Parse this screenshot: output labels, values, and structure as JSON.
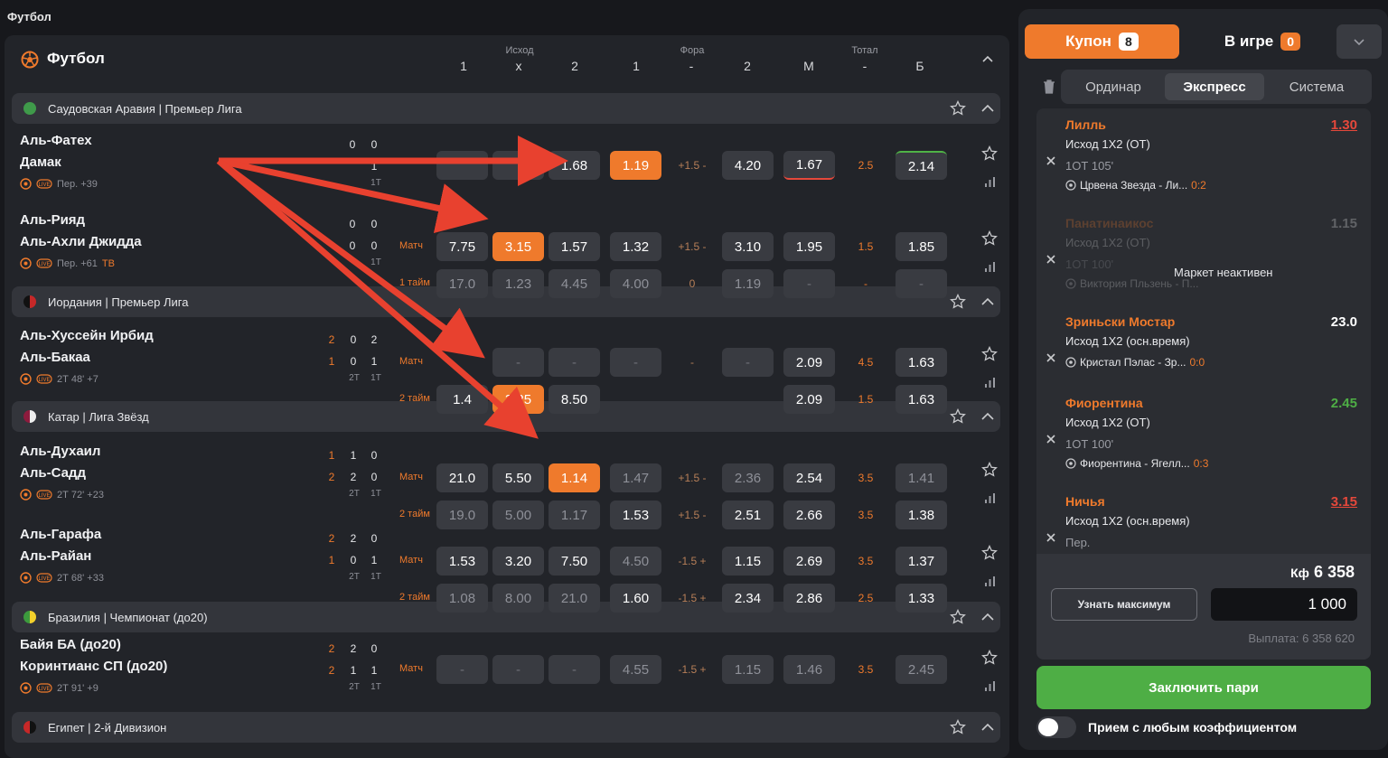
{
  "page_title": "Футбол",
  "header": {
    "sport": "Футбол",
    "groups": [
      "Исход",
      "Фора",
      "Тотал"
    ],
    "cols": [
      "1",
      "x",
      "2",
      "1",
      "-",
      "2",
      "М",
      "-",
      "Б"
    ]
  },
  "leagues": [
    "Саудовская Аравия | Премьер Лига",
    "Иордания | Премьер Лига",
    "Катар | Лига Звёзд",
    "Бразилия | Чемпионат (до20)",
    "Египет | 2-й Дивизион"
  ],
  "events": [
    {
      "t1": "Аль-Фатех",
      "t2": "Дамак",
      "meta": "Пер. +39",
      "meta2": "",
      "scores": [
        [
          "",
          "",
          "0",
          "0"
        ],
        [
          "",
          "",
          "",
          "1"
        ]
      ],
      "periods": [
        "",
        "1Т"
      ],
      "rows": [
        {
          "market": "",
          "odds": [
            "",
            "",
            "1.68",
            "1.19",
            "+1.5 -",
            "4.20",
            "1.67",
            "2.5",
            "2.14"
          ]
        }
      ]
    },
    {
      "t1": "Аль-Рияд",
      "t2": "Аль-Ахли Джидда",
      "meta": "Пер. +61",
      "meta2": "ТВ",
      "scores": [
        [
          "",
          "",
          "0",
          "0"
        ],
        [
          "",
          "",
          "0",
          "0"
        ]
      ],
      "periods": [
        "",
        "1Т"
      ],
      "rows": [
        {
          "market": "Матч",
          "odds": [
            "7.75",
            "3.15",
            "1.57",
            "1.32",
            "+1.5 -",
            "3.10",
            "1.95",
            "1.5",
            "1.85"
          ]
        },
        {
          "market": "1 тайм",
          "odds": [
            "17.0",
            "1.23",
            "4.45",
            "4.00",
            "0",
            "1.19",
            "-",
            "-",
            "-"
          ]
        }
      ]
    },
    {
      "t1": "Аль-Хуссейн Ирбид",
      "t2": "Аль-Бакаа",
      "meta": "2Т 48' +7",
      "meta2": "",
      "scores": [
        [
          "2",
          "0",
          "2"
        ],
        [
          "1",
          "0",
          "1"
        ]
      ],
      "periods": [
        "2Т",
        "1Т"
      ],
      "rows": [
        {
          "market": "Матч",
          "odds": [
            "",
            "-",
            "-",
            "-",
            "-",
            "-",
            "2.09",
            "4.5",
            "1.63"
          ]
        },
        {
          "market": "2 тайм",
          "odds": [
            "1.4",
            "3.25",
            "8.50",
            "",
            "",
            "",
            "2.09",
            "1.5",
            "1.63"
          ]
        }
      ]
    },
    {
      "t1": "Аль-Духаил",
      "t2": "Аль-Садд",
      "meta": "2Т 72' +23",
      "meta2": "",
      "scores": [
        [
          "1",
          "1",
          "0"
        ],
        [
          "2",
          "2",
          "0"
        ]
      ],
      "periods": [
        "2Т",
        "1Т"
      ],
      "rows": [
        {
          "market": "Матч",
          "odds": [
            "21.0",
            "5.50",
            "1.14",
            "1.47",
            "+1.5 -",
            "2.36",
            "2.54",
            "3.5",
            "1.41"
          ]
        },
        {
          "market": "2 тайм",
          "odds": [
            "19.0",
            "5.00",
            "1.17",
            "1.53",
            "+1.5 -",
            "2.51",
            "2.66",
            "3.5",
            "1.38"
          ]
        }
      ]
    },
    {
      "t1": "Аль-Гарафа",
      "t2": "Аль-Райан",
      "meta": "2Т 68' +33",
      "meta2": "",
      "scores": [
        [
          "2",
          "2",
          "0"
        ],
        [
          "1",
          "0",
          "1"
        ]
      ],
      "periods": [
        "2Т",
        "1Т"
      ],
      "rows": [
        {
          "market": "Матч",
          "odds": [
            "1.53",
            "3.20",
            "7.50",
            "4.50",
            "-1.5 +",
            "1.15",
            "2.69",
            "3.5",
            "1.37"
          ]
        },
        {
          "market": "2 тайм",
          "odds": [
            "1.08",
            "8.00",
            "21.0",
            "1.60",
            "-1.5 +",
            "2.34",
            "2.86",
            "2.5",
            "1.33"
          ]
        }
      ]
    },
    {
      "t1": "Байя БА (до20)",
      "t2": "Коринтианс СП (до20)",
      "meta": "2Т 91' +9",
      "meta2": "",
      "scores": [
        [
          "2",
          "2",
          "0"
        ],
        [
          "2",
          "1",
          "1"
        ]
      ],
      "periods": [
        "2Т",
        "1Т"
      ],
      "rows": [
        {
          "market": "Матч",
          "odds": [
            "-",
            "-",
            "-",
            "4.55",
            "-1.5 +",
            "1.15",
            "1.46",
            "3.5",
            "2.45"
          ]
        }
      ]
    }
  ],
  "coupon": {
    "tab_coupon": "Купон",
    "coupon_count": "8",
    "tab_live": "В игре",
    "live_count": "0",
    "modes": [
      "Ординар",
      "Экспресс",
      "Система"
    ],
    "bets": [
      {
        "name": "Лилль",
        "odd": "1.30",
        "market": "Исход 1Х2 (ОТ)",
        "time": "1ОТ 105'",
        "match": "Црвена Звезда - Ли...",
        "score": "0:2"
      },
      {
        "name": "Панатинаикос",
        "odd": "1.15",
        "market": "Исход 1Х2 (ОТ)",
        "time": "1ОТ 100'",
        "match": "Виктория Пльзень - П...",
        "score": "",
        "inactive": "Маркет неактивен"
      },
      {
        "name": "Зриньски Мостар",
        "odd": "23.0",
        "market": "Исход 1Х2 (осн.время)",
        "time": "",
        "match": "Кристал Пэлас - Зр...",
        "score": "0:0"
      },
      {
        "name": "Фиорентина",
        "odd": "2.45",
        "market": "Исход 1Х2 (ОТ)",
        "time": "1ОТ 100'",
        "match": "Фиорентина - Ягелл...",
        "score": "0:3"
      },
      {
        "name": "Ничья",
        "odd": "3.15",
        "market": "Исход 1Х2 (осн.время)",
        "time": "Пер.",
        "match": "",
        "score": ""
      }
    ],
    "kf_label": "Кф",
    "kf_value": "6 358",
    "max_button": "Узнать максимум",
    "amount": "1 000",
    "payout": "Выплата: 6 358 620",
    "submit": "Заключить пари",
    "toggle_label": "Прием с любым коэффициентом"
  },
  "colors": {
    "accent": "#ef7a2c",
    "green": "#4eae45",
    "red": "#e5483b",
    "bg": "#17181c",
    "panel": "#222429"
  }
}
